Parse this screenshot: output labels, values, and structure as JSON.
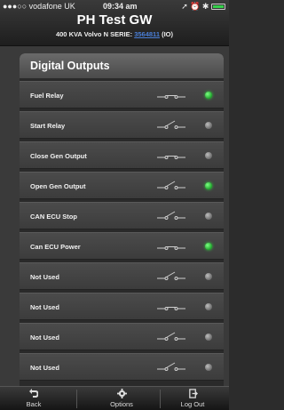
{
  "status_bar": {
    "carrier": "●●●○○ vodafone UK",
    "time": "09:34 am",
    "icons": "➚ ⏰ ✱"
  },
  "header": {
    "title": "PH Test GW",
    "subtitle_prefix": "400 KVA Volvo N SERIE:",
    "serial": "3564811",
    "subtitle_suffix": "(IO)"
  },
  "panel": {
    "title": "Digital Outputs",
    "rows": [
      {
        "label": "Fuel Relay",
        "switch": "closed",
        "led": "on"
      },
      {
        "label": "Start Relay",
        "switch": "open",
        "led": "off"
      },
      {
        "label": "Close Gen Output",
        "switch": "closed",
        "led": "off"
      },
      {
        "label": "Open Gen Output",
        "switch": "open",
        "led": "on"
      },
      {
        "label": "CAN ECU Stop",
        "switch": "open",
        "led": "off"
      },
      {
        "label": "Can ECU Power",
        "switch": "closed",
        "led": "on"
      },
      {
        "label": "Not Used",
        "switch": "open",
        "led": "off"
      },
      {
        "label": "Not Used",
        "switch": "closed",
        "led": "off"
      },
      {
        "label": "Not Used",
        "switch": "open",
        "led": "off"
      },
      {
        "label": "Not Used",
        "switch": "open",
        "led": "off"
      }
    ]
  },
  "nav": {
    "back_label": "Back",
    "options_label": "Options",
    "logout_label": "Log Out"
  },
  "colors": {
    "led_on": "#2fd63d",
    "led_off": "#8a8a8a",
    "serial_link": "#4a7fd8"
  }
}
